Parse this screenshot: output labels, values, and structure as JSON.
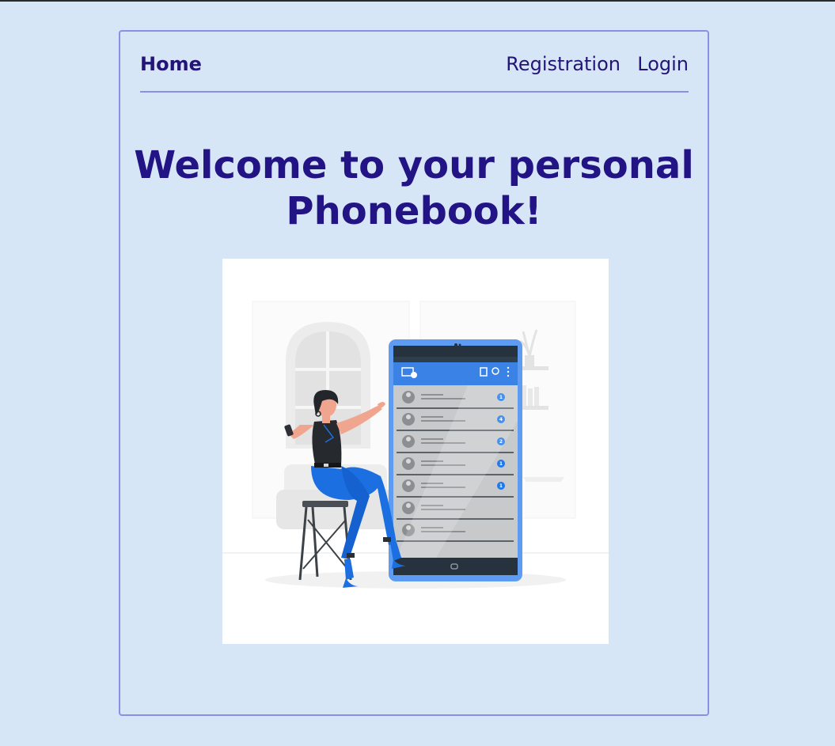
{
  "nav": {
    "home_label": "Home",
    "registration_label": "Registration",
    "login_label": "Login"
  },
  "hero": {
    "title": "Welcome to your personal Phonebook!",
    "illustration": "woman-with-giant-phone-contacts-illustration",
    "contact_badges": [
      "1",
      "4",
      "2",
      "1",
      "1"
    ]
  },
  "colors": {
    "page_background": "#d7e6f6",
    "card_border": "#8b8fe6",
    "title": "#231485",
    "nav_text": "#231477",
    "phone_blue": "#5d9cf2"
  }
}
